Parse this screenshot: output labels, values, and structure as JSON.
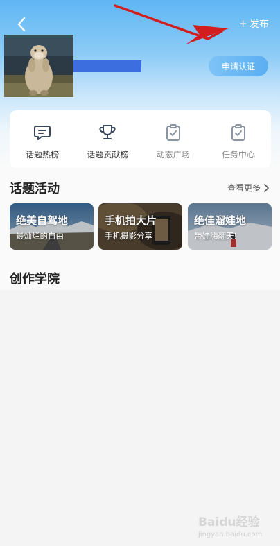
{
  "header": {
    "publish_plus": "+",
    "publish_label": "发布",
    "apply_button": "申请认证"
  },
  "quick_menu": [
    {
      "label": "话题热榜",
      "icon": "chat-list-icon"
    },
    {
      "label": "话题贡献榜",
      "icon": "trophy-icon"
    },
    {
      "label": "动态广场",
      "icon": "clipboard-check-icon"
    },
    {
      "label": "任务中心",
      "icon": "clipboard-check-icon"
    }
  ],
  "topics_section": {
    "title": "话题活动",
    "see_more": "查看更多"
  },
  "topic_cards": [
    {
      "title": "绝美自驾地",
      "subtitle": "最灿烂的自由"
    },
    {
      "title": "手机拍大片",
      "subtitle": "手机摄影分享"
    },
    {
      "title": "绝佳溜娃地",
      "subtitle": "带娃嗨翻天!"
    }
  ],
  "academy_section": {
    "title": "创作学院"
  },
  "watermark": {
    "logo": "Baidu经验",
    "url": "jingyan.baidu.com"
  },
  "colors": {
    "header_blue": "#5fb6f3",
    "annotation_red": "#d21e1e",
    "redact_blue": "#3d6ee0"
  }
}
